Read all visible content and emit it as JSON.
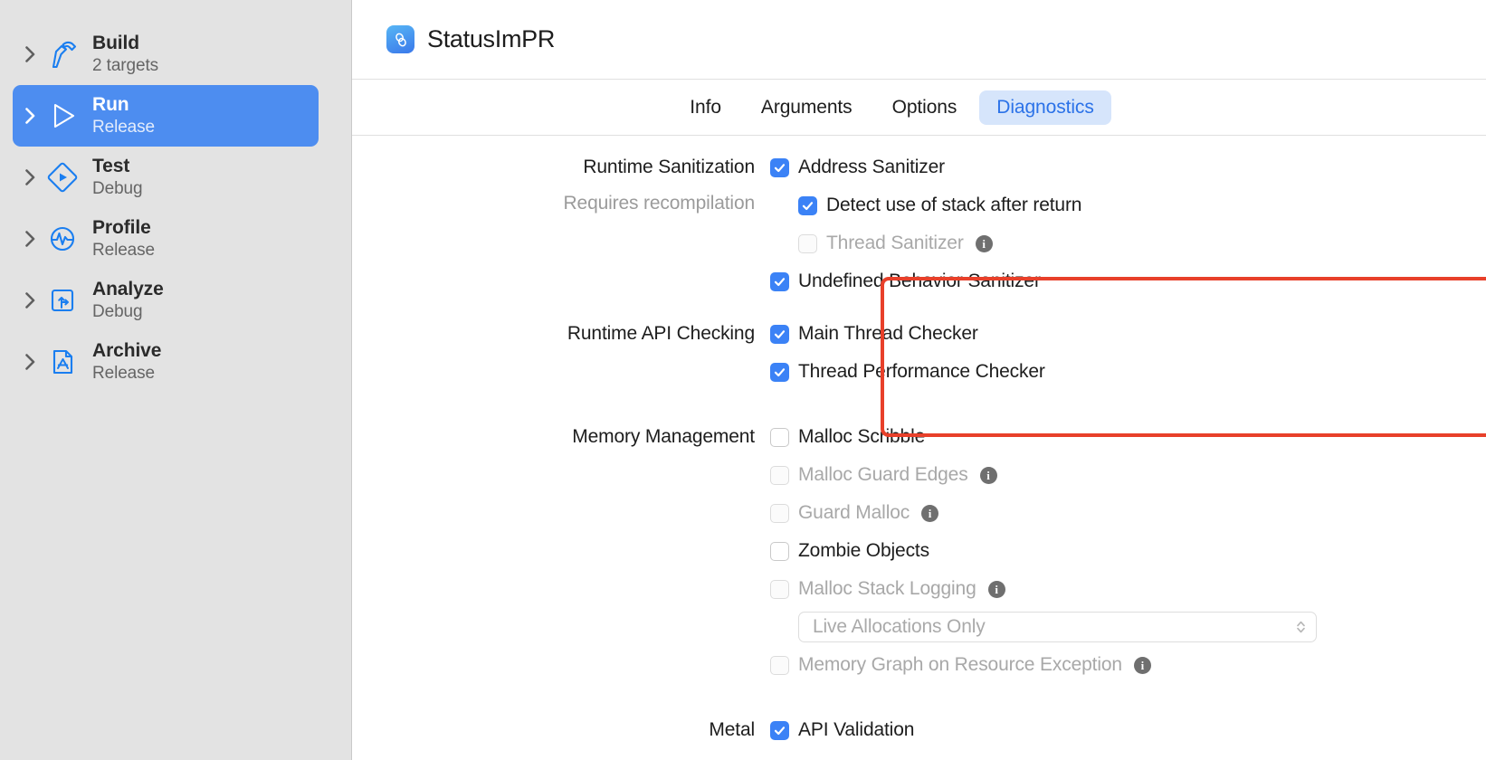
{
  "window": {
    "title": "StatusImPR"
  },
  "sidebar": {
    "items": [
      {
        "name": "build",
        "title": "Build",
        "subtitle": "2 targets",
        "icon": "hammer-icon",
        "selected": false
      },
      {
        "name": "run",
        "title": "Run",
        "subtitle": "Release",
        "icon": "play-icon",
        "selected": true
      },
      {
        "name": "test",
        "title": "Test",
        "subtitle": "Debug",
        "icon": "test-diamond-icon",
        "selected": false
      },
      {
        "name": "profile",
        "title": "Profile",
        "subtitle": "Release",
        "icon": "waveform-icon",
        "selected": false
      },
      {
        "name": "analyze",
        "title": "Analyze",
        "subtitle": "Debug",
        "icon": "analyze-icon",
        "selected": false
      },
      {
        "name": "archive",
        "title": "Archive",
        "subtitle": "Release",
        "icon": "archive-icon",
        "selected": false
      }
    ]
  },
  "header": {
    "app_icon": "statusimpr-app-icon",
    "title": "StatusImPR"
  },
  "tabs": [
    {
      "label": "Info",
      "active": false
    },
    {
      "label": "Arguments",
      "active": false
    },
    {
      "label": "Options",
      "active": false
    },
    {
      "label": "Diagnostics",
      "active": true
    }
  ],
  "sections": {
    "runtime_sanitization": {
      "label": "Runtime Sanitization",
      "sublabel": "Requires recompilation",
      "options": [
        {
          "label": "Address Sanitizer",
          "checked": true,
          "enabled": true,
          "indented": false,
          "info": false
        },
        {
          "label": "Detect use of stack after return",
          "checked": true,
          "enabled": true,
          "indented": true,
          "info": false
        },
        {
          "label": "Thread Sanitizer",
          "checked": false,
          "enabled": false,
          "indented": true,
          "info": true
        },
        {
          "label": "Undefined Behavior Sanitizer",
          "checked": true,
          "enabled": true,
          "indented": false,
          "info": false
        }
      ]
    },
    "runtime_api_checking": {
      "label": "Runtime API Checking",
      "options": [
        {
          "label": "Main Thread Checker",
          "checked": true,
          "enabled": true,
          "indented": false,
          "info": false
        },
        {
          "label": "Thread Performance Checker",
          "checked": true,
          "enabled": true,
          "indented": false,
          "info": false
        }
      ]
    },
    "memory_management": {
      "label": "Memory Management",
      "options": [
        {
          "label": "Malloc Scribble",
          "checked": false,
          "enabled": true,
          "indented": false,
          "info": false
        },
        {
          "label": "Malloc Guard Edges",
          "checked": false,
          "enabled": false,
          "indented": false,
          "info": true
        },
        {
          "label": "Guard Malloc",
          "checked": false,
          "enabled": false,
          "indented": false,
          "info": true
        },
        {
          "label": "Zombie Objects",
          "checked": false,
          "enabled": true,
          "indented": false,
          "info": false
        },
        {
          "label": "Malloc Stack Logging",
          "checked": false,
          "enabled": false,
          "indented": false,
          "info": true
        }
      ],
      "stack_logging_mode": {
        "value": "Live Allocations Only",
        "enabled": false
      },
      "memory_graph_option": {
        "label": "Memory Graph on Resource Exception",
        "checked": false,
        "enabled": false,
        "info": true
      }
    },
    "metal": {
      "label": "Metal",
      "options": [
        {
          "label": "API Validation",
          "checked": true,
          "enabled": true,
          "indented": false,
          "info": false
        }
      ]
    }
  },
  "annotation": {
    "target": "runtime-sanitization-section",
    "color": "#e8402a"
  },
  "colors": {
    "accent_blue": "#3b82f6",
    "selection_blue": "#4d8df0",
    "tab_active_bg": "#d6e5fb",
    "tab_active_text": "#2b72e8",
    "sidebar_bg": "#e3e3e3",
    "disabled_text": "#a8a8a8",
    "highlight_red": "#e8402a"
  }
}
